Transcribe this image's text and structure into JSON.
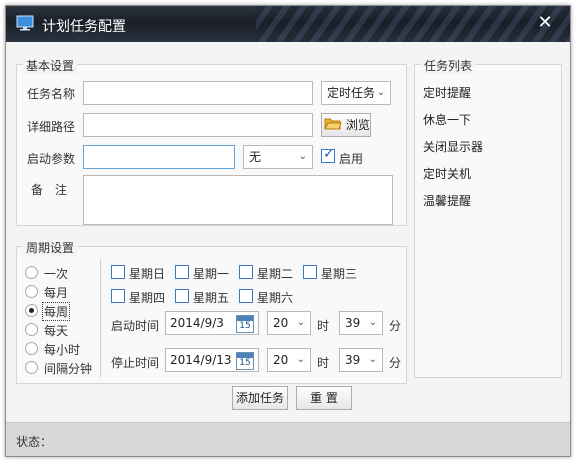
{
  "window": {
    "title": "计划任务配置",
    "close_glyph": "✕"
  },
  "basic": {
    "legend": "基本设置",
    "task_name_label": "任务名称",
    "task_name_value": "",
    "task_type_value": "定时任务",
    "path_label": "详细路径",
    "path_value": "",
    "browse_label": "浏览",
    "param_label": "启动参数",
    "param_value": "",
    "param_select_value": "无",
    "enable_label": "启用",
    "enable_checked": true,
    "note_label": "备　注",
    "note_value": ""
  },
  "cycle": {
    "legend": "周期设置",
    "options": [
      "一次",
      "每月",
      "每周",
      "每天",
      "每小时",
      "间隔分钟"
    ],
    "selected_option": "每周",
    "weekdays": [
      "星期日",
      "星期一",
      "星期二",
      "星期三",
      "星期四",
      "星期五",
      "星期六"
    ],
    "start_label": "启动时间",
    "start_date": "2014/9/3",
    "start_hour": "20",
    "start_minute": "39",
    "stop_label": "停止时间",
    "stop_date": "2014/9/13",
    "stop_hour": "20",
    "stop_minute": "39",
    "hour_unit": "时",
    "minute_unit": "分",
    "cal_day": "15"
  },
  "actions": {
    "add_label": "添加任务",
    "reset_label": "重 置"
  },
  "task_list": {
    "legend": "任务列表",
    "items": [
      "定时提醒",
      "休息一下",
      "关闭显示器",
      "定时关机",
      "温馨提醒"
    ]
  },
  "status": {
    "label": "状态："
  },
  "colors": {
    "titlebar": "#1a1f27",
    "accent": "#3a78c6"
  },
  "icons": {
    "app": "monitor-icon",
    "browse": "folder-icon",
    "calendar": "calendar-icon",
    "dropdown": "chevron-down-icon"
  }
}
